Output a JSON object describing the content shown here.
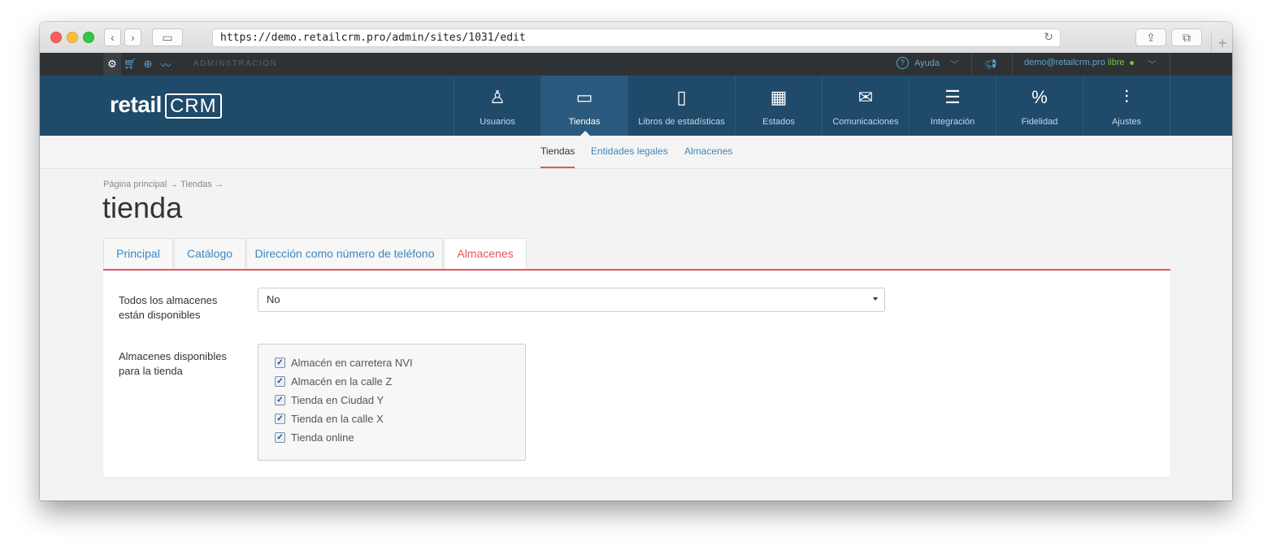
{
  "browser": {
    "url": "https://demo.retailcrm.pro/admin/sites/1031/edit"
  },
  "topbar": {
    "section": "ADMINSTRACIÓN",
    "help": "Ayuda",
    "user_email": "demo@retailcrm.pro",
    "user_status": "libre"
  },
  "header": {
    "logo_prefix": "retail",
    "logo_crm": "CRM",
    "nav": [
      {
        "label": "Usuarios",
        "icon": "user-icon"
      },
      {
        "label": "Tiendas",
        "icon": "store-window-icon"
      },
      {
        "label": "Libros de estadísticas",
        "icon": "book-icon"
      },
      {
        "label": "Estados",
        "icon": "grid-icon"
      },
      {
        "label": "Comunicaciones",
        "icon": "envelope-icon"
      },
      {
        "label": "Integración",
        "icon": "lines-icon"
      },
      {
        "label": "Fidelidad",
        "icon": "percent-tag-icon"
      },
      {
        "label": "Ajustes",
        "icon": "sliders-icon"
      }
    ]
  },
  "subnav": [
    "Tiendas",
    "Entidades legales",
    "Almacenes"
  ],
  "breadcrumb": "Página principal → Tiendas →",
  "page_title": "tienda",
  "tabs": [
    "Principal",
    "Catálogo",
    "Dirección como número de teléfono",
    "Almacenes"
  ],
  "form": {
    "all_warehouses_label": "Todos los almacenes están disponibles",
    "all_warehouses_value": "No",
    "available_label": "Almacenes disponibles para la tienda",
    "warehouses": [
      "Almacén en carretera NVI",
      "Almacén en la calle Z",
      "Tienda en Ciudad Y",
      "Tienda en la calle X",
      "Tienda online"
    ]
  },
  "colors": {
    "header_bg": "#1f4a6a",
    "accent_red": "#e5555f",
    "link_blue": "#3b87c0"
  }
}
